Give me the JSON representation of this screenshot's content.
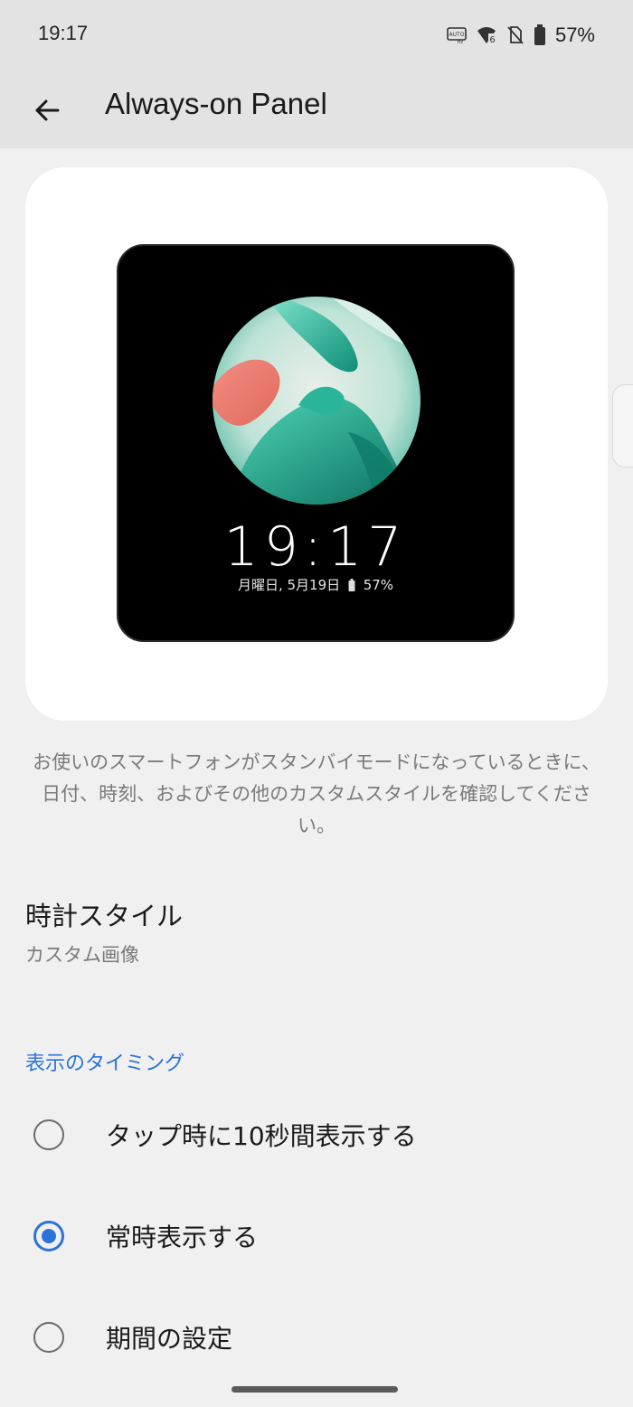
{
  "status_bar": {
    "time": "19:17",
    "auto_hz_label": "AUTO\nHz",
    "wifi_label": "6",
    "battery_percent": "57%"
  },
  "app_bar": {
    "title": "Always-on Panel",
    "back_icon": "arrow-left"
  },
  "preview": {
    "clock": "19:17",
    "date": "月曜日, 5月19日",
    "battery": "57%"
  },
  "description": "お使いのスマートフォンがスタンバイモードになっているときに、日付、時刻、およびその他のカスタムスタイルを確認してください。",
  "clock_style": {
    "title": "時計スタイル",
    "value": "カスタム画像"
  },
  "timing": {
    "header": "表示のタイミング",
    "options": [
      {
        "label": "タップ時に10秒間表示する",
        "selected": false
      },
      {
        "label": "常時表示する",
        "selected": true
      },
      {
        "label": "期間の設定",
        "selected": false
      }
    ]
  },
  "colors": {
    "accent": "#2a73d9",
    "background": "#f0f0f0",
    "app_bar": "#e3e3e3"
  }
}
